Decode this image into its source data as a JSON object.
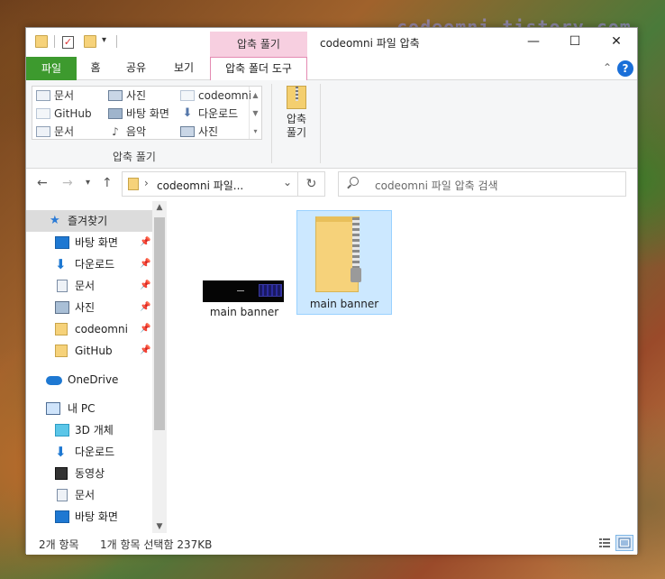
{
  "watermark": "codeomni.tistory.com",
  "title": {
    "window_title": "codeomni 파일 압축",
    "context_tab_group": "압축 풀기",
    "minimize": "—",
    "maximize": "☐",
    "close": "✕"
  },
  "ribbon_tabs": {
    "file": "파일",
    "home": "홈",
    "share": "공유",
    "view": "보기",
    "context": "압축 폴더 도구"
  },
  "ribbon": {
    "destinations": [
      "문서",
      "GitHub",
      "문서",
      "사진",
      "바탕 화면",
      "음악",
      "codeomni",
      "다운로드",
      "사진"
    ],
    "extract_to_group_label": "압축 풀기",
    "extract_all_label_1": "압축",
    "extract_all_label_2": "풀기"
  },
  "address": {
    "path": "codeomni 파일...",
    "search_placeholder": "codeomni 파일 압축 검색"
  },
  "nav_pane": {
    "quick_access": "즐겨찾기",
    "items": [
      "바탕 화면",
      "다운로드",
      "문서",
      "사진",
      "codeomni",
      "GitHub"
    ],
    "onedrive": "OneDrive",
    "this_pc": "내 PC",
    "pc_items": [
      "3D 개체",
      "다운로드",
      "동영상",
      "문서",
      "바탕 화면"
    ]
  },
  "files": [
    {
      "name": "main banner",
      "type": "image"
    },
    {
      "name": "main banner",
      "type": "zip"
    }
  ],
  "status": {
    "item_count": "2개 항목",
    "selection": "1개 항목 선택함 237KB"
  }
}
